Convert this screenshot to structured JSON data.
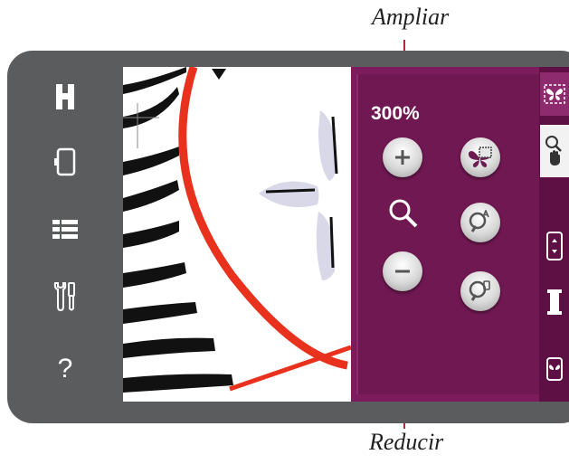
{
  "annotations": {
    "zoom_in_label": "Ampliar",
    "zoom_out_label": "Reducir"
  },
  "zoom_panel": {
    "zoom_level": "300%"
  },
  "sidebar": {
    "items": [
      {
        "icon": "h-logo-icon"
      },
      {
        "icon": "hoop-icon"
      },
      {
        "icon": "list-icon"
      },
      {
        "icon": "tools-icon"
      },
      {
        "icon": "help-icon",
        "label": "?"
      }
    ]
  },
  "colors": {
    "device_frame": "#5b5c5e",
    "screen_bg": "#7d1c5c",
    "panel_bg": "#701852",
    "leader_line": "#b32a3c",
    "stitch_red": "#e8321e"
  }
}
